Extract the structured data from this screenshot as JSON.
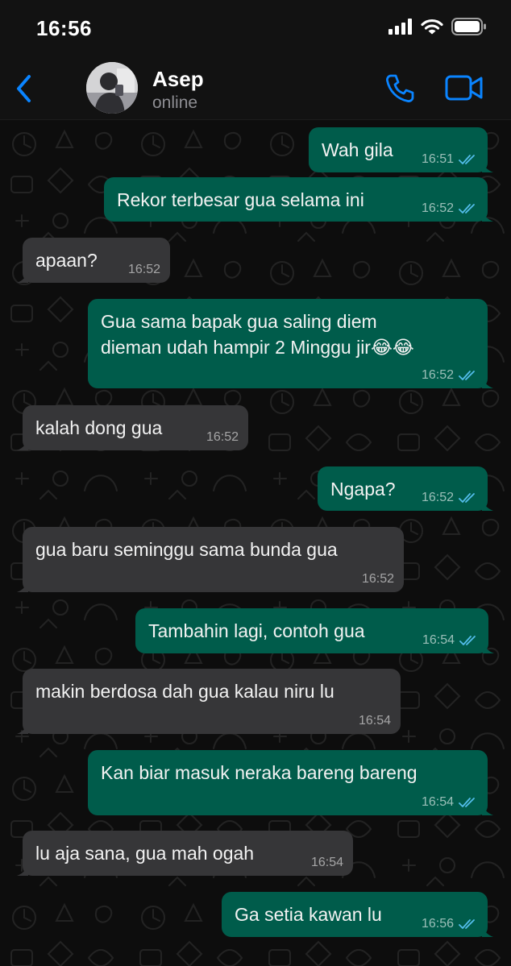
{
  "status_bar": {
    "time": "16:56",
    "icons": [
      "signal-icon",
      "wifi-icon",
      "battery-icon"
    ]
  },
  "header": {
    "back_icon": "chevron-left-icon",
    "contact_name": "Asep",
    "contact_status": "online",
    "actions": [
      "phone-icon",
      "video-camera-icon"
    ],
    "accent_color": "#0a84ff"
  },
  "colors": {
    "outgoing_bubble": "#005c4b",
    "incoming_bubble": "#363638",
    "read_ticks": "#53bdeb"
  },
  "messages": [
    {
      "direction": "out",
      "text": "Wah gila",
      "time": "16:51",
      "status": "read"
    },
    {
      "direction": "out",
      "text": "Rekor terbesar gua selama ini",
      "time": "16:52",
      "status": "read"
    },
    {
      "direction": "in",
      "text": "apaan?",
      "time": "16:52"
    },
    {
      "direction": "out",
      "text": "Gua sama bapak gua saling diem\ndieman udah hampir 2 Minggu jir😂😂",
      "time": "16:52",
      "status": "read"
    },
    {
      "direction": "in",
      "text": "kalah dong gua",
      "time": "16:52"
    },
    {
      "direction": "out",
      "text": "Ngapa?",
      "time": "16:52",
      "status": "read"
    },
    {
      "direction": "in",
      "text": "gua baru seminggu sama bunda gua",
      "time": "16:52"
    },
    {
      "direction": "out",
      "text": "Tambahin lagi, contoh gua",
      "time": "16:54",
      "status": "read"
    },
    {
      "direction": "in",
      "text": "makin berdosa dah gua kalau niru lu",
      "time": "16:54"
    },
    {
      "direction": "out",
      "text": "Kan biar masuk neraka bareng bareng",
      "time": "16:54",
      "status": "read"
    },
    {
      "direction": "in",
      "text": "lu aja sana, gua mah ogah",
      "time": "16:54"
    },
    {
      "direction": "out",
      "text": "Ga setia kawan lu",
      "time": "16:56",
      "status": "read"
    }
  ]
}
